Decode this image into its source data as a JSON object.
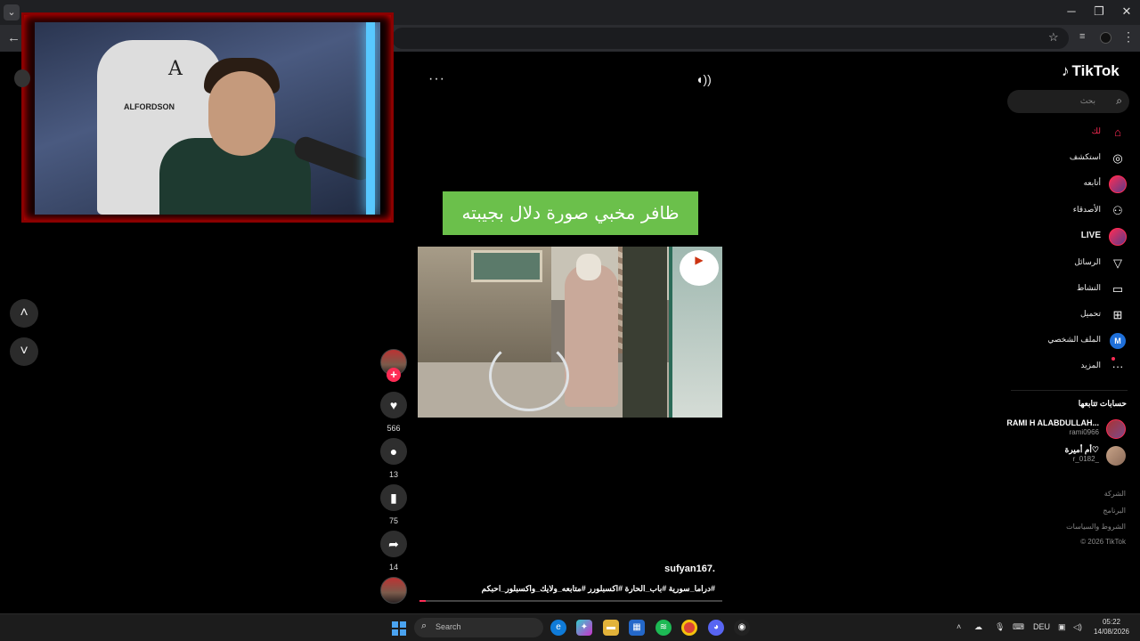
{
  "browser": {
    "window_controls": [
      "─",
      "❐",
      "✕"
    ],
    "back_icon": "arrow-left-icon",
    "star_icon": "star-icon"
  },
  "nav_arrows": {
    "up": "˄",
    "down": "˅"
  },
  "player": {
    "more_label": "···",
    "sound_icon": "speaker-icon",
    "caption": "ظافر مخبي صورة دلال بجيبته",
    "watermark": "▶",
    "progress_fraction": 0.02
  },
  "actions": {
    "likes": "566",
    "comments": "13",
    "saves": "75",
    "shares": "14",
    "follow_plus": "+"
  },
  "post": {
    "author": "sufyan167.",
    "hashtags": "#دراما_سورية #باب_الحارة #اكسبلورر #متابعه_ولايك_واكسبلور_احبكم"
  },
  "sidebar": {
    "logo": "TikTok",
    "search_placeholder": "بحث",
    "items": [
      {
        "label": "لك",
        "icon": "⌂"
      },
      {
        "label": "استكشف",
        "icon": "◎"
      },
      {
        "label": "أتابعه",
        "icon": ""
      },
      {
        "label": "الأصدقاء",
        "icon": "⚇"
      },
      {
        "label": "LIVE",
        "icon": ""
      },
      {
        "label": "الرسائل",
        "icon": "▽"
      },
      {
        "label": "النشاط",
        "icon": "▭"
      },
      {
        "label": "تحميل",
        "icon": "⊞"
      },
      {
        "label": "الملف الشخصي",
        "icon": "M"
      },
      {
        "label": "المزيد",
        "icon": "···"
      }
    ],
    "following_title": "حسابات تتابعها",
    "accounts": [
      {
        "name": "RAMI H ALABDULLAH...",
        "handle": "rami0966"
      },
      {
        "name": "أم أميرة♡",
        "handle": "r_0182_"
      }
    ],
    "footer": [
      "الشركة",
      "البرنامج",
      "الشروط والسياسات",
      "© 2026 TikTok"
    ]
  },
  "taskbar": {
    "search_label": "Search",
    "lang": "DEU",
    "time": "05:22",
    "date": "14/08/2026"
  },
  "colors": {
    "accent": "#fe2c55",
    "caption_bg": "#6bc04b"
  }
}
